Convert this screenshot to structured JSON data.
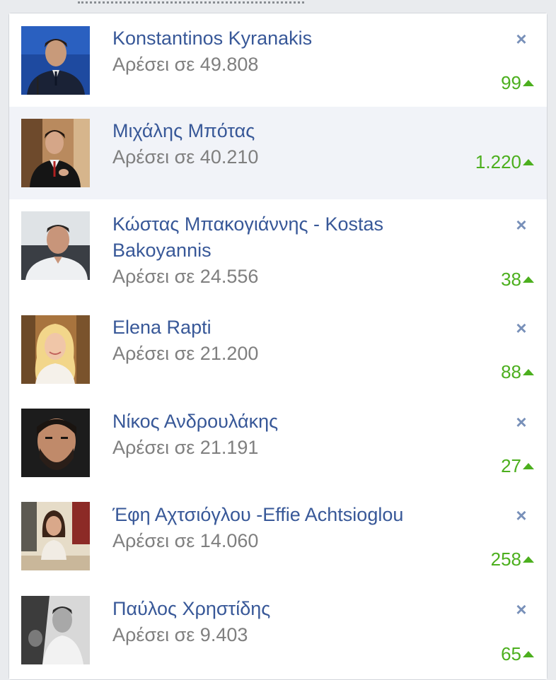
{
  "pages": [
    {
      "name": "Konstantinos Kyranakis",
      "likes": "Αρέσει σε 49.808",
      "growth": "99",
      "avatar": "portrait-man-blue-backdrop",
      "dismissible": true
    },
    {
      "name": "Μιχάλης Μπότας",
      "likes": "Αρέσει σε 40.210",
      "growth": "1.220",
      "avatar": "portrait-man-red-tie",
      "dismissible": false
    },
    {
      "name": "Κώστας Μπακογιάννης - Kostas Bakoyannis",
      "likes": "Αρέσει σε 24.556",
      "growth": "38",
      "avatar": "portrait-man-white-shirt",
      "dismissible": true
    },
    {
      "name": "Elena Rapti",
      "likes": "Αρέσει σε 21.200",
      "growth": "88",
      "avatar": "portrait-woman-blonde",
      "dismissible": true
    },
    {
      "name": "Νίκος Ανδρουλάκης",
      "likes": "Αρέσει σε 21.191",
      "growth": "27",
      "avatar": "portrait-man-beard",
      "dismissible": true
    },
    {
      "name": "Έφη Αχτσιόγλου -Effie Achtsioglou",
      "likes": "Αρέσει σε 14.060",
      "growth": "258",
      "avatar": "portrait-woman-office",
      "dismissible": true
    },
    {
      "name": "Παύλος Χρηστίδης",
      "likes": "Αρέσει σε 9.403",
      "growth": "65",
      "avatar": "portrait-man-black-white",
      "dismissible": true
    }
  ],
  "icons": {
    "dismiss": "close-icon",
    "trend": "triangle-up-icon"
  },
  "colors": {
    "name": "#385898",
    "likes": "#7f7f7f",
    "growth": "#4caf1e",
    "dismiss": "#7890b9",
    "highlight_row": "#f1f3f8"
  }
}
